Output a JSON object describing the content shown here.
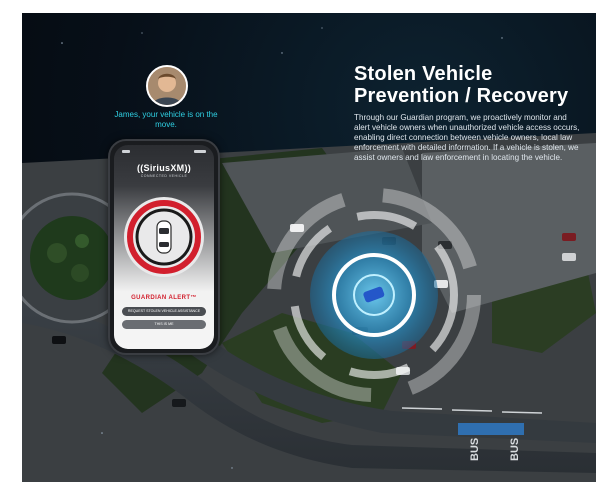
{
  "headline": {
    "line1": "Stolen Vehicle",
    "line2": "Prevention / Recovery"
  },
  "body": "Through our Guardian program, we proactively monitor and alert vehicle owners when unauthorized vehicle access occurs, enabling direct connection between vehicle owners, local law enforcement with detailed information. If a vehicle is stolen, we assist owners and law enforcement in locating the vehicle.",
  "notification": {
    "message": "James, your vehicle is on the move."
  },
  "phone": {
    "brand": "((SiriusXM))",
    "brand_sub": "CONNECTED VEHICLE",
    "alert_title": "GUARDIAN ALERT™",
    "request_button": "REQUEST STOLEN VEHICLE ASSISTANCE",
    "this_is_me_button": "THIS IS ME"
  },
  "road_markings": {
    "bus1": "BUS",
    "bus2": "BUS"
  },
  "colors": {
    "accent_cyan": "#2fd0e3",
    "alert_red": "#d21f2d",
    "radar_blue": "#3fa9d8"
  }
}
